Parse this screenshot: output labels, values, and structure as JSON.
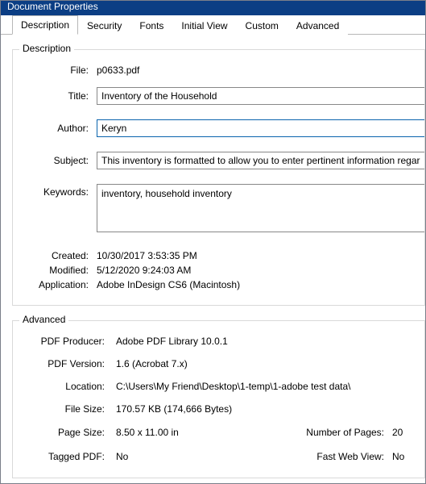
{
  "window": {
    "title": "Document Properties"
  },
  "tabs": {
    "description": "Description",
    "security": "Security",
    "fonts": "Fonts",
    "initial_view": "Initial View",
    "custom": "Custom",
    "advanced": "Advanced"
  },
  "group_description": {
    "title": "Description",
    "labels": {
      "file": "File:",
      "title": "Title:",
      "author": "Author:",
      "subject": "Subject:",
      "keywords": "Keywords:",
      "created": "Created:",
      "modified": "Modified:",
      "application": "Application:"
    },
    "values": {
      "file": "p0633.pdf",
      "title": "Inventory of the Household",
      "author": "Keryn",
      "subject": "This inventory is formatted to allow you to enter pertinent information regarding",
      "keywords": "inventory, household inventory",
      "created": "10/30/2017 3:53:35 PM",
      "modified": "5/12/2020 9:24:03 AM",
      "application": "Adobe InDesign CS6 (Macintosh)"
    }
  },
  "group_advanced": {
    "title": "Advanced",
    "labels": {
      "pdf_producer": "PDF Producer:",
      "pdf_version": "PDF Version:",
      "location": "Location:",
      "file_size": "File Size:",
      "page_size": "Page Size:",
      "number_of_pages": "Number of Pages:",
      "tagged_pdf": "Tagged PDF:",
      "fast_web_view": "Fast Web View:"
    },
    "values": {
      "pdf_producer": "Adobe PDF Library 10.0.1",
      "pdf_version": "1.6 (Acrobat 7.x)",
      "location": "C:\\Users\\My Friend\\Desktop\\1-temp\\1-adobe test data\\",
      "file_size": "170.57 KB (174,666 Bytes)",
      "page_size": "8.50 x 11.00 in",
      "number_of_pages": "20",
      "tagged_pdf": "No",
      "fast_web_view": "No"
    }
  }
}
